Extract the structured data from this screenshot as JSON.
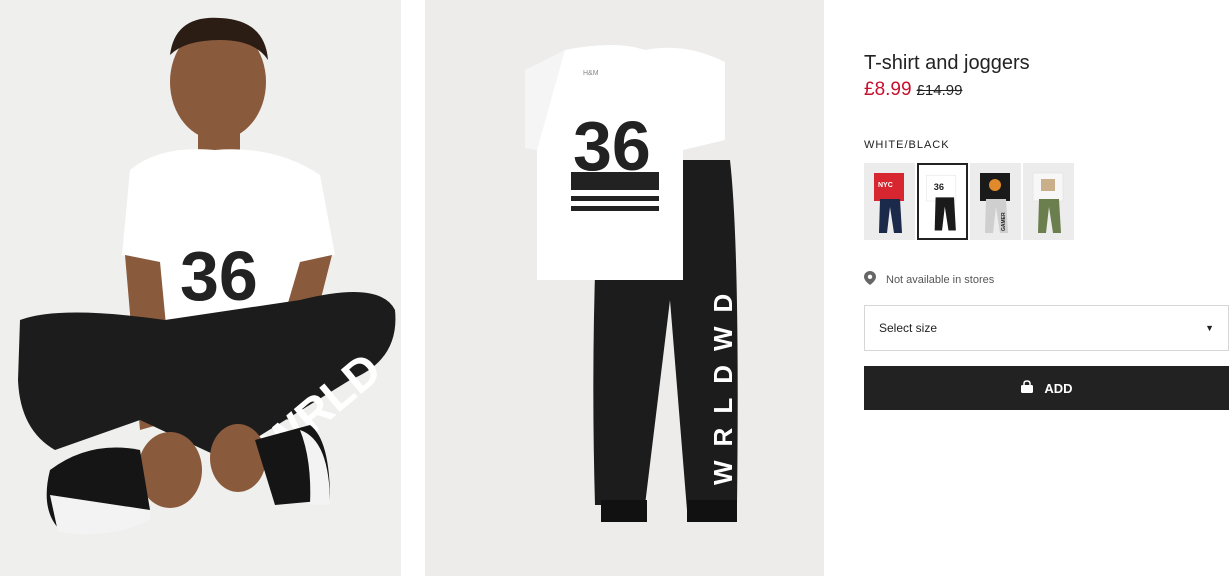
{
  "product": {
    "title": "T-shirt and joggers",
    "price_sale": "£8.99",
    "price_original": "£14.99",
    "color_name": "WHITE/BLACK",
    "swatches": [
      {
        "name": "red-navy",
        "top": "#d7262f",
        "bottom": "#1b2a4a",
        "selected": false,
        "print": "NYC"
      },
      {
        "name": "white-black",
        "top": "#ffffff",
        "bottom": "#1a1a1a",
        "selected": true,
        "print": "36"
      },
      {
        "name": "black-grey",
        "top": "#1a1a1a",
        "bottom": "#cfcfcf",
        "selected": false,
        "print": "GAMER"
      },
      {
        "name": "white-khaki",
        "top": "#f7f7f7",
        "bottom": "#6b7f4e",
        "selected": false,
        "print": ""
      }
    ],
    "availability": "Not available in stores",
    "size_select": "Select size",
    "add_label": "ADD",
    "photo_print_number": "36",
    "photo_print_word": "WRLDWD",
    "photo_leg_word_model": "WRLD",
    "photo_brand": "H&M",
    "icons": [
      "location-pin-icon",
      "chevron-down-icon",
      "shopping-bag-icon"
    ]
  },
  "colors": {
    "sale": "#c8102e",
    "button": "#222222",
    "border": "#d6d6d6"
  }
}
